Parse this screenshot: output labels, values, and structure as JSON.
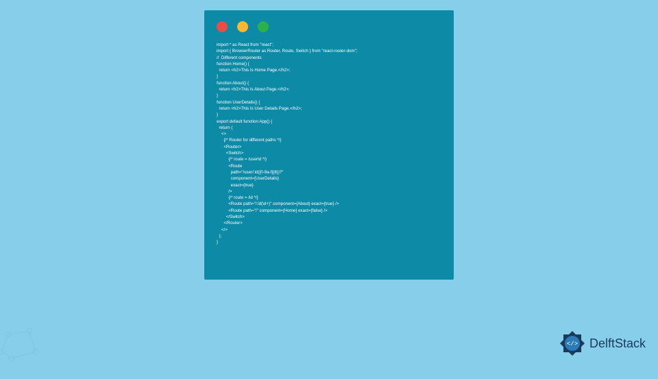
{
  "code": {
    "lines": [
      "import * as React from \"react\";",
      "import { BrowserRouter as Router, Route, Switch } from \"react-router-dom\";",
      "//  Different components",
      "function Home() {",
      "  return <h2>This Is Home Page.</h2>;",
      "}",
      "function About() {",
      "  return <h2>This Is About Page.</h2>;",
      "}",
      "function UserDetails() {",
      "  return <h2>This Is User Details Page.</h2>;",
      "}",
      "export default function App() {",
      "  return (",
      "    <>",
      "      {/* Router for different paths */}",
      "      <Router>",
      "        <Switch>",
      "          {/* route = /userId */}",
      "          <Route",
      "            path=\"/user/:id([0-9a-f]{8})?\"",
      "            component={UserDetails}",
      "            exact={true}",
      "          />",
      "          {/* route = /id */}",
      "          <Route path=\"/:id(\\d+)\" component={About} exact={true} />",
      "          <Route path=\"/\" component={Home} exact={false} />",
      "        </Switch>",
      "      </Router>",
      "    </>",
      "  );",
      "}"
    ]
  },
  "brand": {
    "name": "DelftStack"
  },
  "colors": {
    "bg": "#87ceeb",
    "window": "#0d8aa6",
    "text": "#ffffff",
    "brand": "#1a3a5c"
  }
}
